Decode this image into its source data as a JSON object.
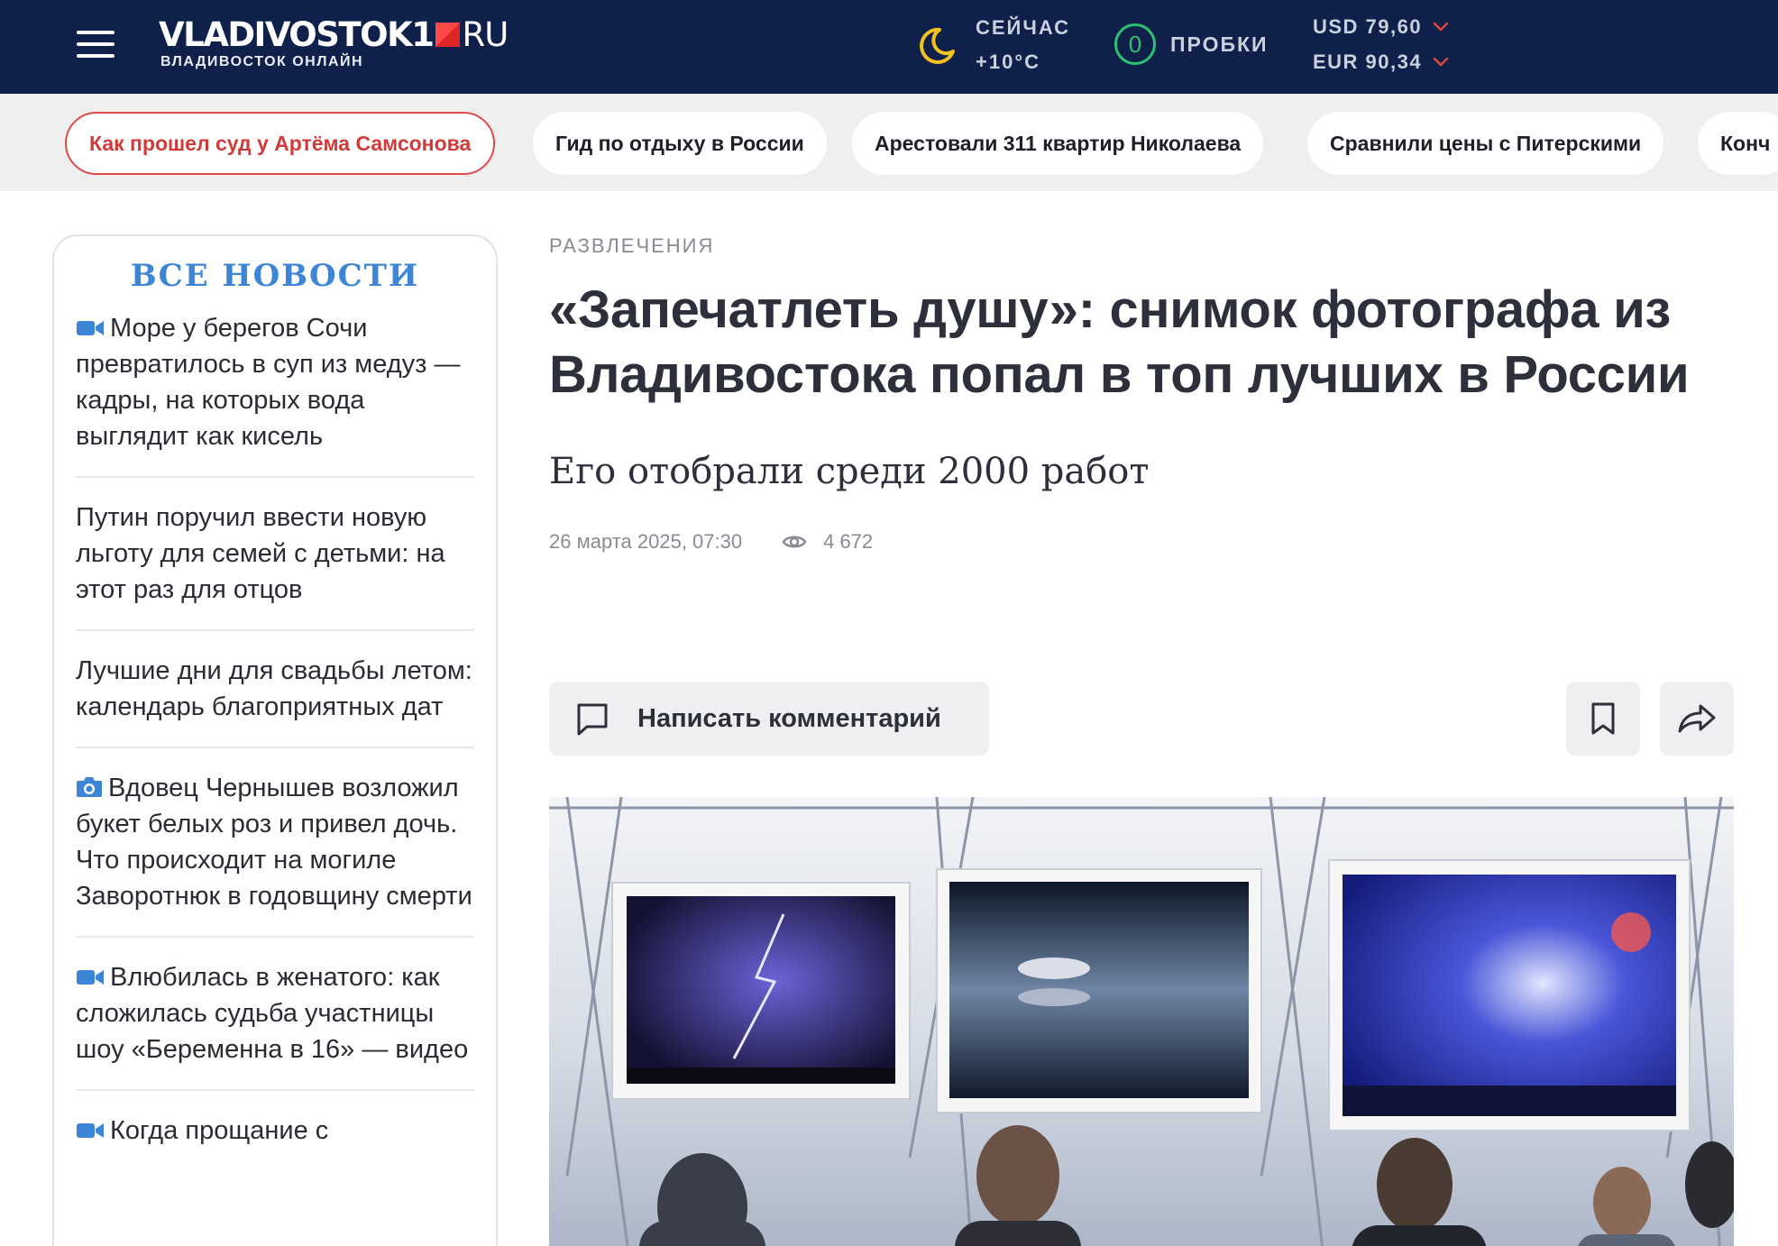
{
  "header": {
    "logo_name": "VLADIVOSTOK1",
    "logo_domain": "RU",
    "logo_subtitle": "ВЛАДИВОСТОК ОНЛАЙН",
    "weather": {
      "label": "СЕЙЧАС",
      "temp": "+10°C",
      "icon": "moon-icon"
    },
    "traffic": {
      "level": "0",
      "label": "ПРОБКИ"
    },
    "rates": [
      {
        "text": "USD 79,60",
        "trend": "down"
      },
      {
        "text": "EUR 90,34",
        "trend": "down"
      }
    ],
    "colors": {
      "bar": "#0f214a",
      "traffic": "#2fbf71",
      "trend_down": "#e0473f"
    }
  },
  "tags": [
    {
      "label": "Как прошел суд у Артёма Самсонова",
      "highlight": true
    },
    {
      "label": "Гид по отдыху в России"
    },
    {
      "label": "Арестовали 311 квартир Николаева"
    },
    {
      "label": "Сравнили цены с Питерскими"
    },
    {
      "label": "Конч"
    }
  ],
  "sidebar": {
    "title": "ВСЕ НОВОСТИ",
    "items": [
      {
        "icon": "video-icon",
        "text": "Море у берегов Сочи превратилось в суп из медуз — кадры, на которых вода выглядит как кисель"
      },
      {
        "icon": "",
        "text": "Путин поручил ввести новую льготу для семей с детьми: на этот раз для отцов"
      },
      {
        "icon": "",
        "text": "Лучшие дни для свадьбы летом: календарь благоприятных дат"
      },
      {
        "icon": "camera-icon",
        "text": "Вдовец Чернышев возложил букет белых роз и привел дочь. Что происходит на могиле Заворотнюк в годовщину смерти"
      },
      {
        "icon": "video-icon",
        "text": "Влюбилась в женатого: как сложилась судьба участницы шоу «Беременна в 16» — видео"
      },
      {
        "icon": "video-icon",
        "text": "Когда прощание с"
      }
    ]
  },
  "article": {
    "rubric": "РАЗВЛЕЧЕНИЯ",
    "title": "«Запечатлеть душу»: снимок фотографа из Владивостока попал в топ лучших в России",
    "lead": "Его отобрали среди 2000 работ",
    "date": "26 марта 2025, 07:30",
    "views": "4 672",
    "comment_label": "Написать комментарий"
  }
}
